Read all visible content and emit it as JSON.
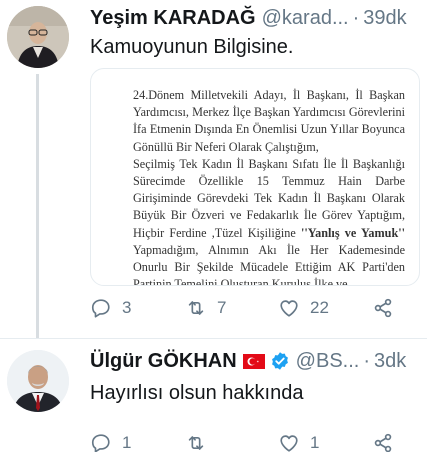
{
  "tweets": [
    {
      "name": "Yeşim KARADAĞ",
      "handle": "@karad...",
      "separator": "·",
      "time": "39dk",
      "text": "Kamuoyunun Bilgisine.",
      "document": {
        "paragraph1": "24.Dönem Milletvekili Adayı, İl Başkanı, İl Başkan Yardımcısı, Merkez İlçe Başkan Yardımcısı Görevlerini İfa Etmenin Dışında En Önemlisi Uzun Yıllar Boyunca Gönüllü Bir Neferi Olarak Çalıştığım,",
        "paragraph2_a": "Seçilmiş Tek Kadın İl Başkanı Sıfatı İle İl Başkanlığı Sürecimde Özellikle 15 Temmuz Hain Darbe Girişiminde Görevdeki Tek Kadın İl Başkanı Olarak Büyük Bir Özveri ve Fedakarlık İle Görev Yaptığım, Hiçbir Ferdine ,Tüzel Kişiliğine ",
        "paragraph2_quote": "''Yanlış ve Yamuk''",
        "paragraph2_b": " Yapmadığım, Alnımın Akı İle Her Kademesinde Onurlu Bir Şekilde Mücadele Ettiğim AK Parti'den Partinin Temelini Oluşturan Kuruluş İlke ve"
      },
      "actions": {
        "replies": "3",
        "retweets": "7",
        "likes": "22"
      }
    },
    {
      "name": "Ülgür GÖKHAN",
      "handle": "@BS...",
      "separator": "·",
      "time": "3dk",
      "text": "Hayırlısı olsun hakkında",
      "actions": {
        "replies": "1",
        "retweets": "",
        "likes": "1"
      }
    }
  ],
  "icons": {
    "reply": "reply-icon",
    "retweet": "retweet-icon",
    "like": "heart-icon",
    "share": "share-icon",
    "flag": "turkey-flag-icon",
    "verified": "verified-badge-icon"
  },
  "colors": {
    "secondary_text": "#657786",
    "verified": "#1da1f2",
    "flag_red": "#e30a17"
  }
}
